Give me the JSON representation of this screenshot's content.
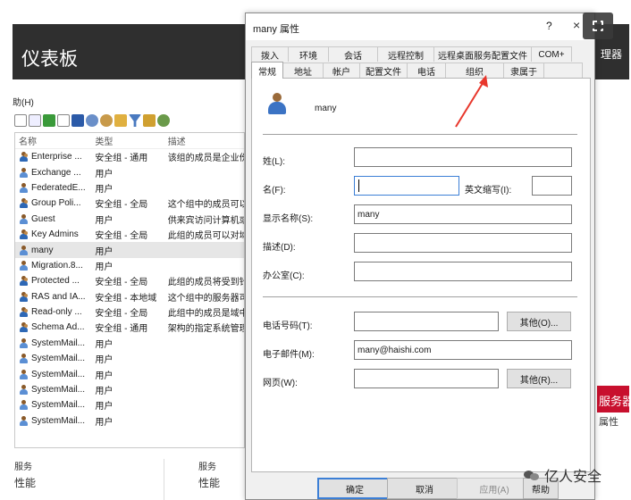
{
  "background_window": {
    "title": "仪表板",
    "right_title_fragment": "理器",
    "menu_fragment": "助(H)",
    "list": {
      "headers": [
        "名称",
        "类型",
        "描述"
      ],
      "rows": [
        {
          "name": "Enterprise ...",
          "type": "安全组 - 通用",
          "desc": "该组的成员是企业份",
          "icon": "group-icon"
        },
        {
          "name": "Exchange ...",
          "type": "用户",
          "desc": "",
          "icon": "user-icon"
        },
        {
          "name": "FederatedE...",
          "type": "用户",
          "desc": "",
          "icon": "user-icon"
        },
        {
          "name": "Group Poli...",
          "type": "安全组 - 全局",
          "desc": "这个组中的成员可以",
          "icon": "group-icon"
        },
        {
          "name": "Guest",
          "type": "用户",
          "desc": "供来宾访问计算机或",
          "icon": "user-icon"
        },
        {
          "name": "Key Admins",
          "type": "安全组 - 全局",
          "desc": "此组的成员可以对域",
          "icon": "group-icon"
        },
        {
          "name": "many",
          "type": "用户",
          "desc": "",
          "icon": "user-icon",
          "selected": true
        },
        {
          "name": "Migration.8...",
          "type": "用户",
          "desc": "",
          "icon": "user-icon"
        },
        {
          "name": "Protected ...",
          "type": "安全组 - 全局",
          "desc": "此组的成员将受到针",
          "icon": "group-icon"
        },
        {
          "name": "RAS and IA...",
          "type": "安全组 - 本地域",
          "desc": "这个组中的服务器可",
          "icon": "group-icon"
        },
        {
          "name": "Read-only ...",
          "type": "安全组 - 全局",
          "desc": "此组中的成员是域中",
          "icon": "group-icon"
        },
        {
          "name": "Schema Ad...",
          "type": "安全组 - 通用",
          "desc": "架构的指定系统管理",
          "icon": "group-icon"
        },
        {
          "name": "SystemMail...",
          "type": "用户",
          "desc": "",
          "icon": "user-icon"
        },
        {
          "name": "SystemMail...",
          "type": "用户",
          "desc": "",
          "icon": "user-icon"
        },
        {
          "name": "SystemMail...",
          "type": "用户",
          "desc": "",
          "icon": "user-icon"
        },
        {
          "name": "SystemMail...",
          "type": "用户",
          "desc": "",
          "icon": "user-icon"
        },
        {
          "name": "SystemMail...",
          "type": "用户",
          "desc": "",
          "icon": "user-icon"
        },
        {
          "name": "SystemMail...",
          "type": "用户",
          "desc": "",
          "icon": "user-icon"
        }
      ]
    },
    "bottom_left": {
      "line1": "服务",
      "line2": "性能"
    },
    "bottom_mid": {
      "line1": "服务",
      "line2": "性能"
    },
    "red_badge": "服务器",
    "attr_text": "属性"
  },
  "dialog": {
    "title": "many 属性",
    "help_glyph": "?",
    "close_glyph": "×",
    "tabs_row1": [
      "拨入",
      "环境",
      "会话",
      "远程控制",
      "远程桌面服务配置文件",
      "COM+"
    ],
    "tabs_row2": [
      "常规",
      "地址",
      "帐户",
      "配置文件",
      "电话",
      "组织",
      "隶属于"
    ],
    "active_tab": "常规",
    "user_name": "many",
    "fields": {
      "surname_label": "姓(L):",
      "surname_value": "",
      "given_label": "名(F):",
      "given_value": "",
      "initials_label": "英文缩写(I):",
      "initials_value": "",
      "display_label": "显示名称(S):",
      "display_value": "many",
      "desc_label": "描述(D):",
      "desc_value": "",
      "office_label": "办公室(C):",
      "office_value": "",
      "phone_label": "电话号码(T):",
      "phone_value": "",
      "email_label": "电子邮件(M):",
      "email_value": "many@haishi.com",
      "web_label": "网页(W):",
      "web_value": ""
    },
    "other_phone_button": "其他(O)...",
    "other_web_button": "其他(R)...",
    "buttons": {
      "ok": "确定",
      "cancel": "取消",
      "apply": "应用(A)",
      "help": "帮助"
    }
  },
  "watermark": "亿人安全",
  "colors": {
    "accent": "#3c7fd6",
    "arrow": "#e8372c",
    "titlebar": "#2f2f2f",
    "red_badge": "#c8102e"
  }
}
